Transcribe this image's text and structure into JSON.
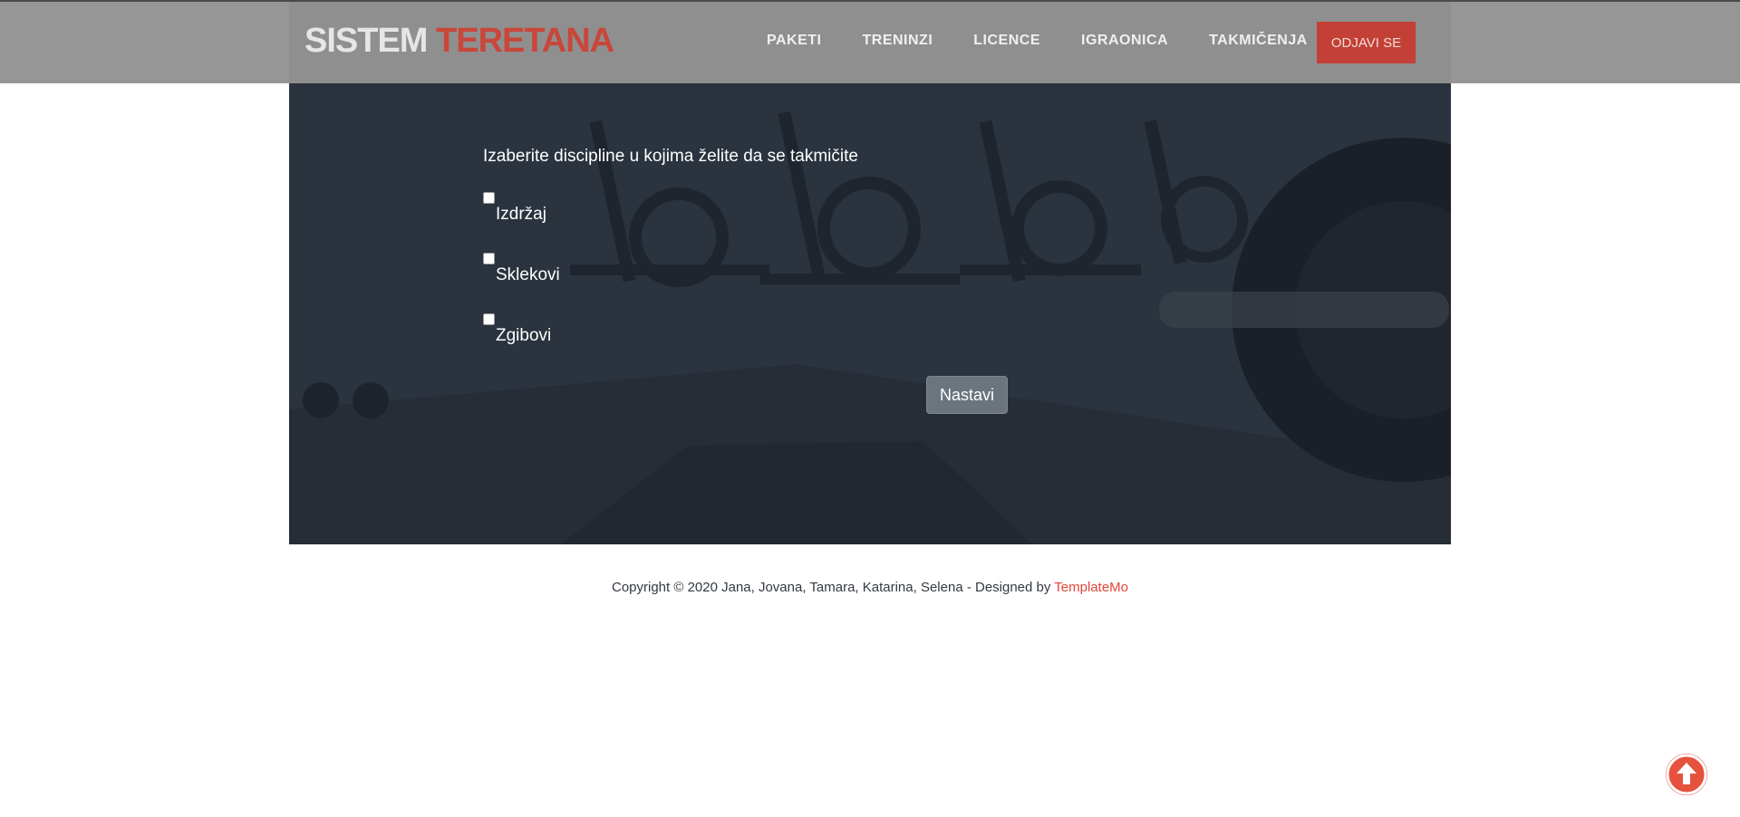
{
  "header": {
    "logo_part1": "SISTEM",
    "logo_part2": "TERETANA",
    "nav": [
      {
        "label": "PAKETI"
      },
      {
        "label": "TRENINZI"
      },
      {
        "label": "LICENCE"
      },
      {
        "label": "IGRAONICA"
      },
      {
        "label": "TAKMIČENJA"
      }
    ],
    "logout_label": "ODJAVI SE"
  },
  "form": {
    "title": "Izaberite discipline u kojima želite da se takmičite",
    "options": [
      {
        "label": "Izdržaj",
        "checked": false
      },
      {
        "label": "Sklekovi",
        "checked": false
      },
      {
        "label": "Zgibovi",
        "checked": false
      }
    ],
    "submit_label": "Nastavi"
  },
  "footer": {
    "text": "Copyright © 2020 Jana, Jovana, Tamara, Katarina, Selena - Designed by",
    "brand": "TemplateMo"
  },
  "icons": {
    "back_to_top": "arrow-up-circle-icon"
  },
  "colors": {
    "accent": "#c9463a",
    "hero_bg": "#2b333e",
    "button_gray": "#6c757d"
  }
}
